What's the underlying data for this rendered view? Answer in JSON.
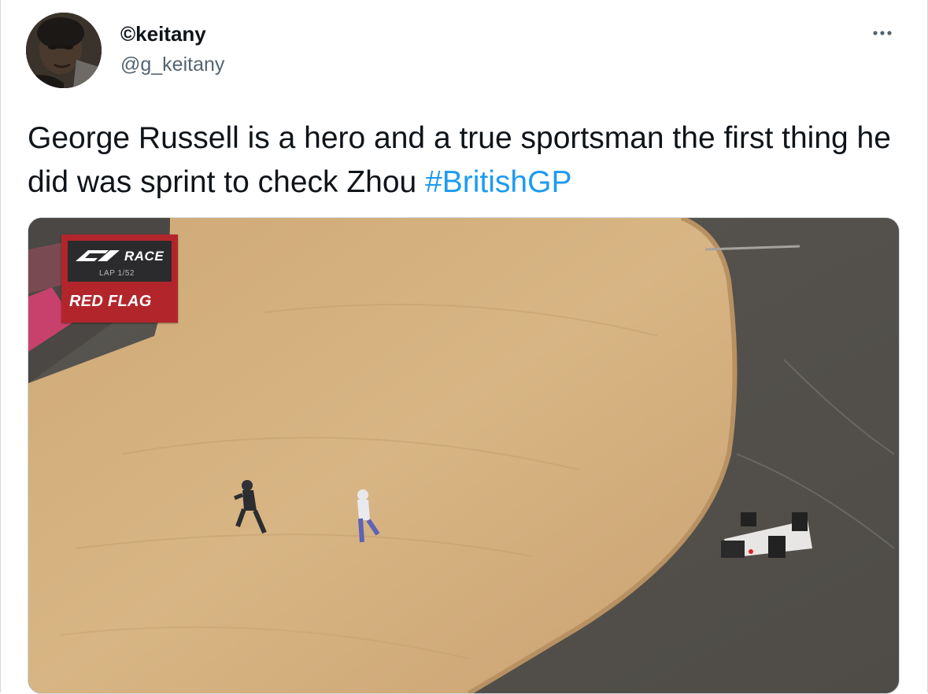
{
  "tweet": {
    "display_name": "©keitany",
    "handle": "@g_keitany",
    "text": "George Russell is a hero and a true sportsman the first thing he did was sprint to check Zhou ",
    "hashtag": "#BritishGP",
    "more_icon": "more-dots-icon",
    "avatar_icon": "user-avatar"
  },
  "media": {
    "overlay": {
      "race_label": "RACE",
      "lap_label": "LAP 1/52",
      "status": "RED FLAG"
    },
    "colors": {
      "gravel": "#d4ae7c",
      "tarmac": "#5c5955",
      "flag_red": "#b2262b"
    }
  },
  "colors": {
    "link": "#1d9bf0",
    "secondary_text": "#536471",
    "primary_text": "#0f1419"
  }
}
